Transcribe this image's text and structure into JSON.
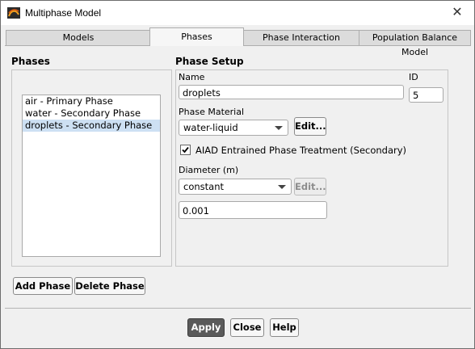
{
  "window": {
    "title": "Multiphase Model"
  },
  "tabs": [
    "Models",
    "Phases",
    "Phase Interaction",
    "Population Balance Model"
  ],
  "phases": {
    "heading": "Phases",
    "items": [
      "air - Primary Phase",
      "water - Secondary Phase",
      "droplets - Secondary Phase"
    ],
    "selected_index": 2,
    "add_label": "Add Phase",
    "delete_label": "Delete Phase"
  },
  "setup": {
    "heading": "Phase Setup",
    "name_label": "Name",
    "name_value": "droplets",
    "id_label": "ID",
    "id_value": "5",
    "material_label": "Phase Material",
    "material_value": "water-liquid",
    "edit_label": "Edit...",
    "aiad_label": "AIAD Entrained Phase Treatment (Secondary)",
    "aiad_checked": true,
    "diameter_label": "Diameter (m)",
    "diameter_method": "constant",
    "diameter_edit_label": "Edit...",
    "diameter_value": "0.001"
  },
  "footer": {
    "apply": "Apply",
    "close": "Close",
    "help": "Help"
  },
  "colors": {
    "selected_row": "#cde0f3",
    "apply_bg": "#5a5a5a"
  },
  "icons": {
    "app": "fluent-app-icon",
    "close": "close-icon",
    "dropdown": "chevron-down-icon",
    "check": "checkmark-icon"
  }
}
